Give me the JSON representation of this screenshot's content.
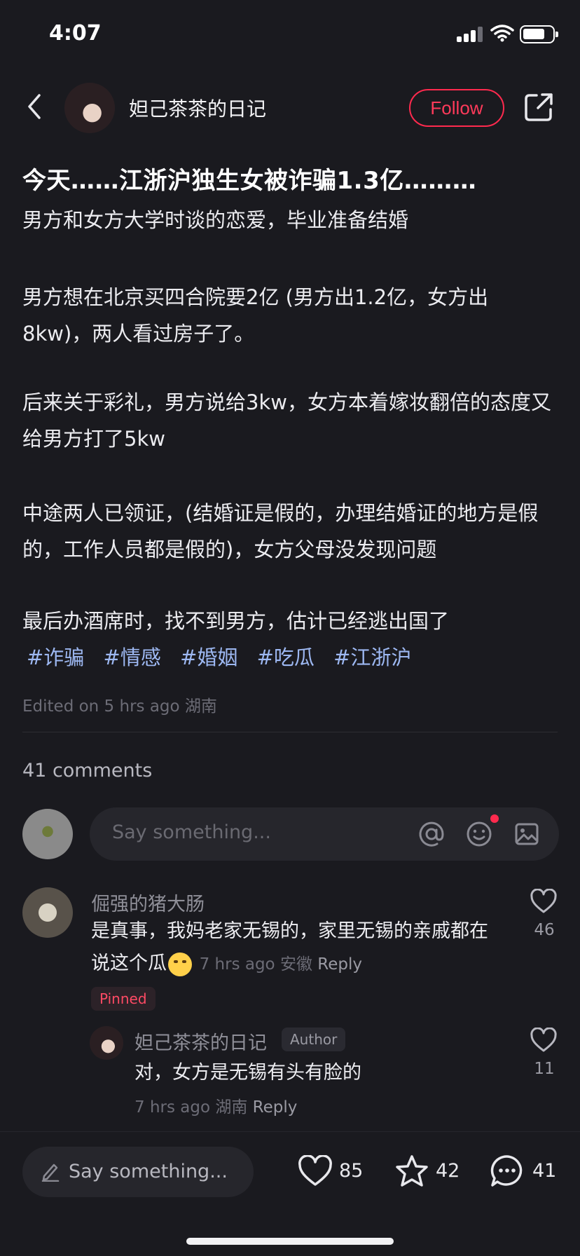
{
  "status_bar": {
    "time": "4:07"
  },
  "header": {
    "author_name": "妲己茶茶的日记",
    "follow_label": "Follow"
  },
  "post": {
    "title": "今天……江浙沪独生女被诈骗1.3亿………",
    "paragraphs": [
      "男方和女方大学时谈的恋爱，毕业准备结婚",
      "男方想在北京买四合院要2亿 (男方出1.2亿，女方出8kw)，两人看过房子了。",
      "后来关于彩礼，男方说给3kw，女方本着嫁妆翻倍的态度又给男方打了5kw",
      "中途两人已领证，(结婚证是假的，办理结婚证的地方是假的，工作人员都是假的)，女方父母没发现问题",
      "最后办酒席时，找不到男方，估计已经逃出国了"
    ],
    "tags": [
      "#诈骗",
      "#情感",
      "#婚姻",
      "#吃瓜",
      "#江浙沪"
    ],
    "edited": "Edited on 5 hrs ago 湖南"
  },
  "comments": {
    "count_label": "41 comments",
    "input_placeholder": "Say something...",
    "items": [
      {
        "name": "倔强的猪大肠",
        "text": "是真事，我妈老家无锡的，家里无锡的亲戚都在说这个瓜",
        "time": "7 hrs ago 安徽",
        "reply": "Reply",
        "likes": "46",
        "pinned": "Pinned"
      }
    ],
    "reply": {
      "name": "妲己茶茶的日记",
      "badge": "Author",
      "text": "对，女方是无锡有头有脸的",
      "time": "7 hrs ago 湖南",
      "reply": "Reply",
      "likes": "11"
    }
  },
  "bottom_bar": {
    "input_placeholder": "Say something...",
    "likes": "85",
    "stars": "42",
    "comments": "41"
  },
  "colors": {
    "accent": "#ff2a4e",
    "background": "#1a1a1f",
    "tag": "#9db8f2"
  }
}
